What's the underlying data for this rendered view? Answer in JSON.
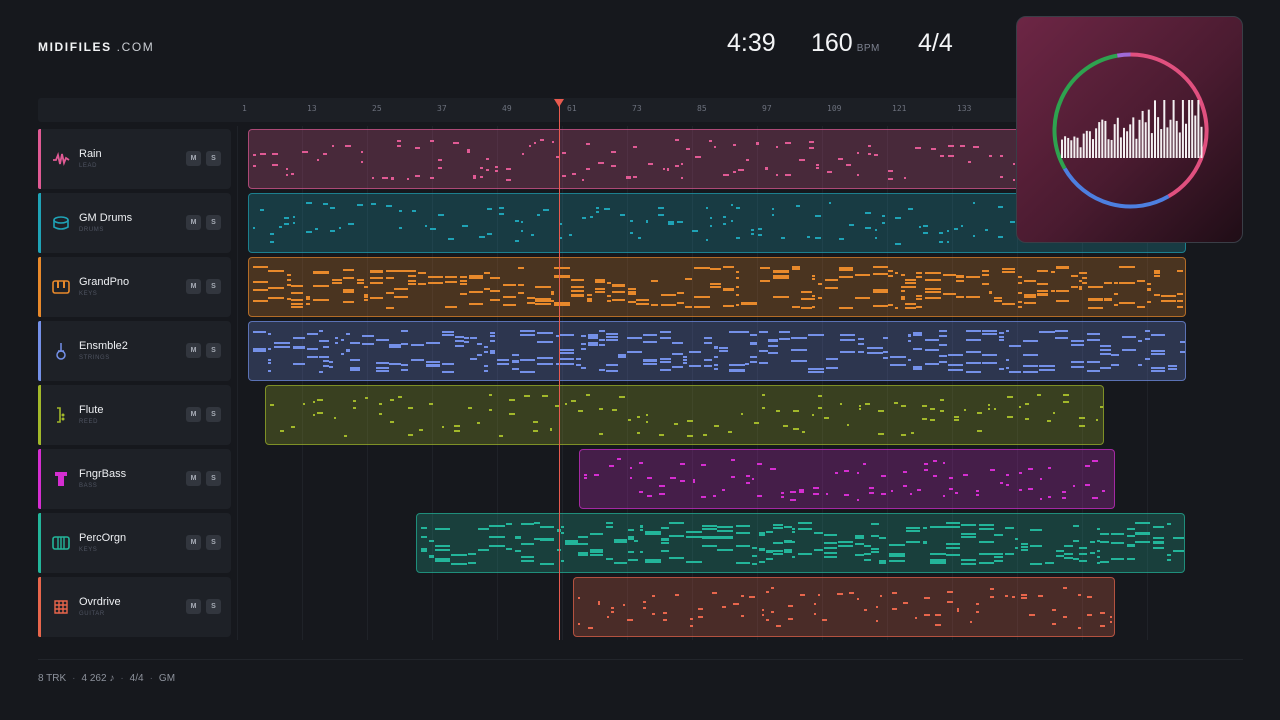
{
  "brand": {
    "bold": "MIDIFILES",
    "light": " .COM"
  },
  "transport": {
    "time": "4:39",
    "tempo": "160",
    "tempo_unit": "BPM",
    "signature": "4/4"
  },
  "ruler": {
    "marks": [
      "1",
      "13",
      "25",
      "37",
      "49",
      "61",
      "73",
      "85",
      "97",
      "109",
      "121",
      "133"
    ]
  },
  "playhead": {
    "bar": 61
  },
  "tracks": [
    {
      "name": "Rain",
      "type": "LEAD",
      "icon": "waveform-icon",
      "color": "#e05a94",
      "clip_start": 1.5,
      "clip_end": 175,
      "mute_label": "M",
      "solo_label": "S"
    },
    {
      "name": "GM Drums",
      "type": "DRUMS",
      "icon": "drum-icon",
      "color": "#1fa3b6",
      "clip_start": 1,
      "clip_end": 175,
      "mute_label": "M",
      "solo_label": "S"
    },
    {
      "name": "GrandPno",
      "type": "KEYS",
      "icon": "piano-icon",
      "color": "#e8892b",
      "clip_start": 1.5,
      "clip_end": 175,
      "mute_label": "M",
      "solo_label": "S"
    },
    {
      "name": "Ensmble2",
      "type": "STRINGS",
      "icon": "violin-icon",
      "color": "#7490e8",
      "clip_start": 1.5,
      "clip_end": 175,
      "mute_label": "M",
      "solo_label": "S"
    },
    {
      "name": "Flute",
      "type": "REED",
      "icon": "flute-icon",
      "color": "#a2b82a",
      "clip_start": 5,
      "clip_end": 160,
      "mute_label": "M",
      "solo_label": "S"
    },
    {
      "name": "FngrBass",
      "type": "BASS",
      "icon": "bass-icon",
      "color": "#d52ed1",
      "clip_start": 63,
      "clip_end": 162,
      "mute_label": "M",
      "solo_label": "S"
    },
    {
      "name": "PercOrgn",
      "type": "KEYS",
      "icon": "organ-icon",
      "color": "#23b59a",
      "clip_start": 33,
      "clip_end": 175,
      "mute_label": "M",
      "solo_label": "S"
    },
    {
      "name": "Ovrdrive",
      "type": "GUITAR",
      "icon": "guitar-icon",
      "color": "#e8664c",
      "clip_start": 62,
      "clip_end": 162,
      "mute_label": "M",
      "solo_label": "S"
    }
  ],
  "album_art": {
    "ring_colors": [
      "#e0507f",
      "#4d7fe0",
      "#2ea24f",
      "#a06ad8"
    ]
  },
  "footer": {
    "tracks": "8 TRK",
    "notes": "4 262 ♪",
    "signature": "4/4",
    "standard": "GM"
  }
}
